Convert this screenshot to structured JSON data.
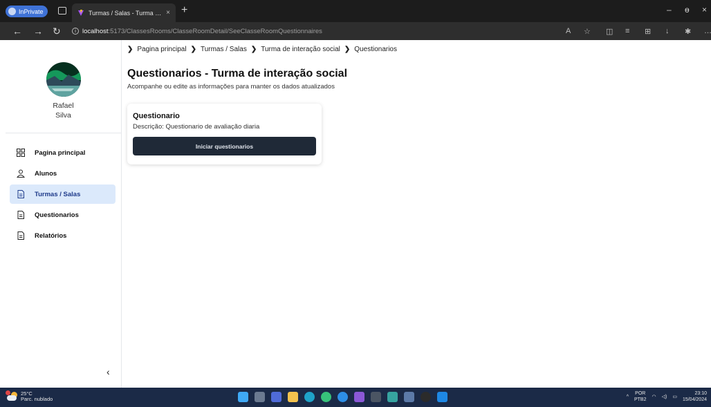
{
  "browser": {
    "inprivate_label": "InPrivate",
    "tab_title": "Turmas / Salas - Turma de intera",
    "tab_close": "×",
    "new_tab": "+",
    "url_host": "localhost",
    "url_path": ":5173/ClassesRooms/ClasseRoomDetail/SeeClasseRoomQuestionnaires",
    "minimize": "–",
    "restore": "ɵ",
    "close": "×"
  },
  "sidebar": {
    "user_first": "Rafael",
    "user_last": "Silva",
    "items": [
      {
        "label": "Pagina principal",
        "icon": "grid-icon"
      },
      {
        "label": "Alunos",
        "icon": "user-icon"
      },
      {
        "label": "Turmas / Salas",
        "icon": "document-icon",
        "active": true
      },
      {
        "label": "Questionarios",
        "icon": "document-icon"
      },
      {
        "label": "Relatórios",
        "icon": "document-icon"
      }
    ],
    "collapse_glyph": "‹"
  },
  "breadcrumb": [
    "Pagina principal",
    "Turmas / Salas",
    "Turma de interação social",
    "Questionarios"
  ],
  "page": {
    "title": "Questionarios - Turma de interação social",
    "subtitle": "Acompanhe ou edite as informações para manter os dados atualizados"
  },
  "card": {
    "title": "Questionario",
    "description": "Descrição: Questionario de avaliação diaria",
    "button": "Iniciar questionarios"
  },
  "taskbar": {
    "temp": "25°C",
    "weather": "Parc. nublado",
    "lang1": "POR",
    "lang2": "PTB2",
    "time": "23:10",
    "date": "15/04/2024"
  },
  "colors": {
    "accent_active_bg": "#dbe9fb",
    "button_bg": "#1f2937",
    "taskbar_bg": "#1b2a47"
  }
}
